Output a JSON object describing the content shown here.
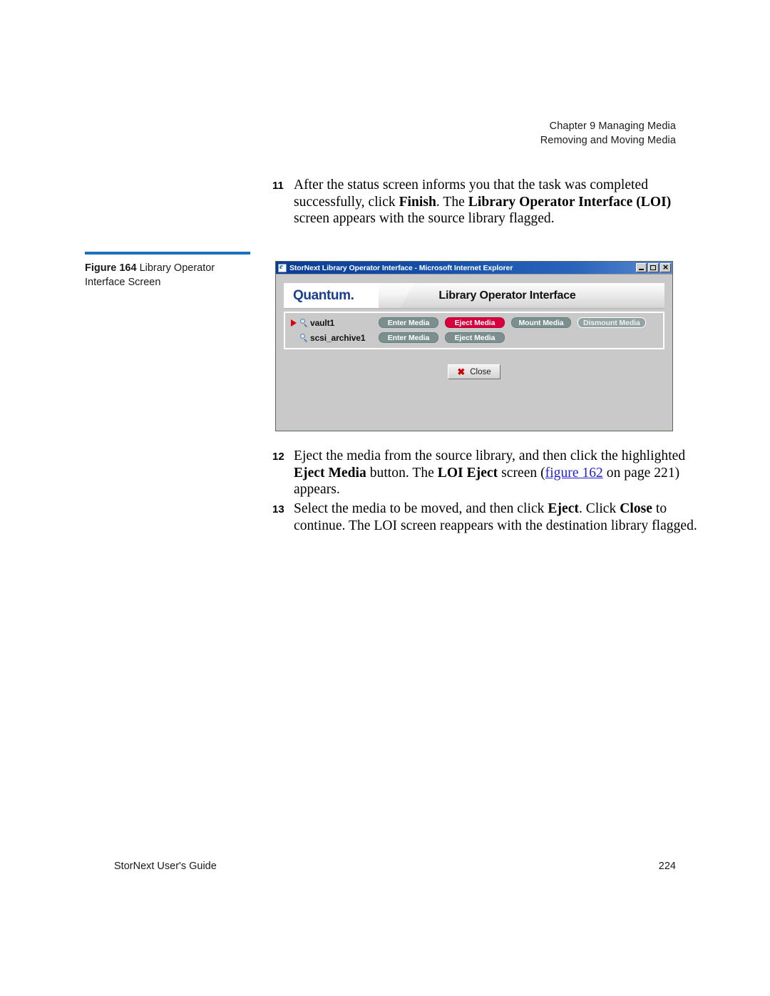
{
  "header": {
    "line1": "Chapter 9  Managing Media",
    "line2": "Removing and Moving Media"
  },
  "steps": [
    {
      "number": "11",
      "segments": [
        {
          "text": "After the status screen informs you that the task was completed successfully, click ",
          "style": "normal"
        },
        {
          "text": "Finish",
          "style": "bold"
        },
        {
          "text": ". The ",
          "style": "normal"
        },
        {
          "text": "Library Operator Interface (LOI)",
          "style": "bold"
        },
        {
          "text": " screen appears with the source library flagged.",
          "style": "normal"
        }
      ]
    },
    {
      "number": "12",
      "segments": [
        {
          "text": "Eject the media from the source library, and then click the highlighted ",
          "style": "normal"
        },
        {
          "text": "Eject Media",
          "style": "bold"
        },
        {
          "text": " button. The ",
          "style": "normal"
        },
        {
          "text": "LOI Eject",
          "style": "bold"
        },
        {
          "text": " screen (",
          "style": "normal"
        },
        {
          "text": "figure 162",
          "style": "link"
        },
        {
          "text": " on page 221) appears.",
          "style": "normal"
        }
      ]
    },
    {
      "number": "13",
      "segments": [
        {
          "text": "Select the media to be moved, and then click ",
          "style": "normal"
        },
        {
          "text": "Eject",
          "style": "bold"
        },
        {
          "text": ". Click ",
          "style": "normal"
        },
        {
          "text": "Close",
          "style": "bold"
        },
        {
          "text": " to continue. The LOI screen reappears with the destination library flagged.",
          "style": "normal"
        }
      ]
    }
  ],
  "figure": {
    "label": "Figure 164",
    "caption": "Library Operator Interface Screen",
    "rule_color": "#1a72bd"
  },
  "browser": {
    "title": "StorNext Library Operator Interface - Microsoft Internet Explorer",
    "icons": {
      "app": "internet-explorer-icon",
      "minimize": "minimize-icon",
      "maximize": "maximize-icon",
      "close": "close-icon"
    },
    "banner": {
      "logo": "Quantum.",
      "title": "Library Operator Interface",
      "logo_color": "#1b3f8f"
    },
    "libraries": [
      {
        "name": "vault1",
        "flagged": true,
        "buttons": [
          {
            "label": "Enter Media",
            "state": "normal"
          },
          {
            "label": "Eject Media",
            "state": "highlighted"
          },
          {
            "label": "Mount Media",
            "state": "normal"
          },
          {
            "label": "Dismount Media",
            "state": "disabled"
          }
        ]
      },
      {
        "name": "scsi_archive1",
        "flagged": false,
        "buttons": [
          {
            "label": "Enter Media",
            "state": "normal"
          },
          {
            "label": "Eject Media",
            "state": "normal"
          }
        ]
      }
    ],
    "close_button": {
      "label": "Close",
      "icon": "red-x-icon"
    },
    "colors": {
      "highlight_red": "#d7003c",
      "button_gray": "#7b8f8f",
      "titlebar_blue": "#0b3c96"
    }
  },
  "footer": {
    "left": "StorNext User's Guide",
    "page": "224"
  }
}
